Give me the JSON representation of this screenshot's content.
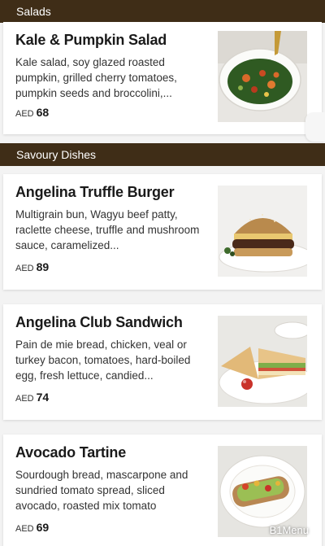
{
  "sections": [
    {
      "title": "Salads",
      "items": [
        {
          "name": "Kale & Pumpkin Salad",
          "description": "Kale salad, soy glazed roasted pumpkin, grilled cherry tomatoes, pumpkin seeds and broccolini,...",
          "currency": "AED",
          "price": "68",
          "image": "salad-bowl-image"
        }
      ]
    },
    {
      "title": "Savoury Dishes",
      "items": [
        {
          "name": "Angelina Truffle Burger",
          "description": "Multigrain bun, Wagyu beef patty, raclette cheese, truffle and mushroom sauce, caramelized...",
          "currency": "AED",
          "price": "89",
          "image": "burger-plate-image"
        },
        {
          "name": "Angelina Club Sandwich",
          "description": "Pain de mie bread, chicken, veal or turkey bacon, tomatoes, hard-boiled egg, fresh lettuce, candied...",
          "currency": "AED",
          "price": "74",
          "image": "club-sandwich-image"
        },
        {
          "name": "Avocado Tartine",
          "description": "Sourdough bread, mascarpone and sundried tomato spread, sliced avocado, roasted mix tomato",
          "currency": "AED",
          "price": "69",
          "image": "avocado-toast-image"
        }
      ]
    }
  ],
  "watermark": "B1Menu",
  "colors": {
    "header_bg": "#3f2d17",
    "header_text": "#ffffff",
    "page_bg": "#f3f3f3",
    "card_bg": "#ffffff"
  }
}
